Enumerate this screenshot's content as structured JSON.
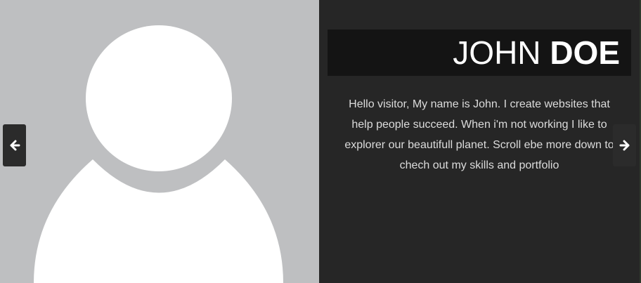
{
  "profile": {
    "first_name": "JOHN",
    "last_name": "DOE",
    "bio": "Hello visitor, My name is John. I create websites that help people succeed. When i'm not working I like to explorer our beautifull planet. Scroll ebe more down to chech out my skills and portfolio"
  },
  "icons": {
    "avatar": "user-silhouette-icon",
    "prev": "arrow-left-icon",
    "next": "arrow-right-icon"
  },
  "colors": {
    "photo_background": "#bebfc1",
    "info_background": "#262626",
    "name_bar": "#141414",
    "text": "#dcdcdc",
    "arrow_button": "#2b2b2b"
  }
}
